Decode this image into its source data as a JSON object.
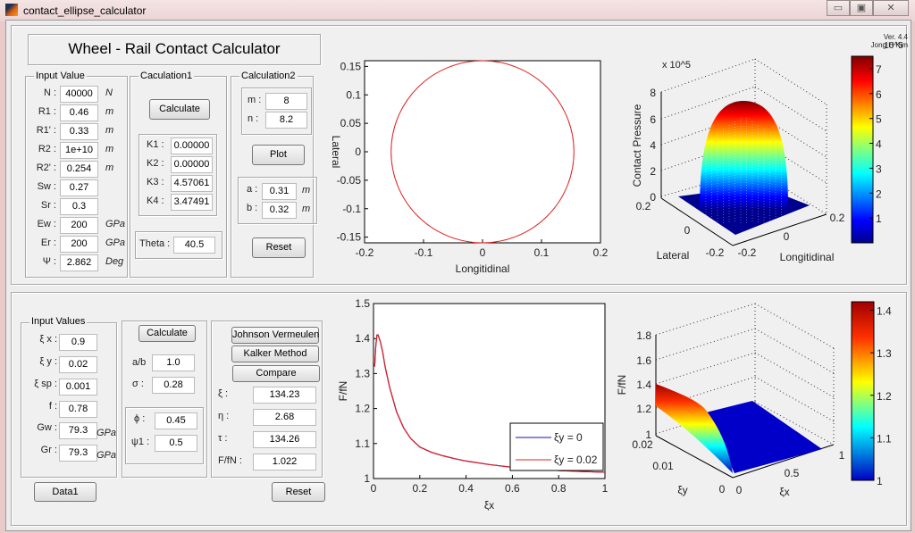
{
  "window": {
    "title": "contact_ellipse_calculator",
    "controls": [
      "minimize",
      "maximize",
      "close"
    ]
  },
  "header": {
    "title": "Wheel - Rail Contact Calculator",
    "version": "Ver. 4.4",
    "author": "Jong H Kim"
  },
  "top": {
    "input_group": {
      "label": "Input Value",
      "rows": [
        {
          "label": "N :",
          "value": "40000",
          "unit": "N"
        },
        {
          "label": "R1 :",
          "value": "0.46",
          "unit": "m"
        },
        {
          "label": "R1' :",
          "value": "0.33",
          "unit": "m"
        },
        {
          "label": "R2 :",
          "value": "1e+10",
          "unit": "m"
        },
        {
          "label": "R2' :",
          "value": "0.254",
          "unit": "m"
        },
        {
          "label": "Sw :",
          "value": "0.27",
          "unit": ""
        },
        {
          "label": "Sr :",
          "value": "0.3",
          "unit": ""
        },
        {
          "label": "Ew :",
          "value": "200",
          "unit": "GPa"
        },
        {
          "label": "Er :",
          "value": "200",
          "unit": "GPa"
        },
        {
          "label": "Ψ :",
          "value": "2.862",
          "unit": "Deg"
        }
      ]
    },
    "calc1": {
      "label": "Caculation1",
      "button": "Calculate",
      "rows": [
        {
          "label": "K1 :",
          "value": "0.00000"
        },
        {
          "label": "K2 :",
          "value": "0.00000"
        },
        {
          "label": "K3 :",
          "value": "4.57061"
        },
        {
          "label": "K4 :",
          "value": "3.47491"
        }
      ],
      "theta_label": "Theta :",
      "theta_value": "40.5"
    },
    "calc2": {
      "label": "Calculation2",
      "m_label": "m :",
      "m_value": "8",
      "n_label": "n :",
      "n_value": "8.2",
      "plot_button": "Plot",
      "a_label": "a :",
      "a_value": "0.31",
      "a_unit": "m",
      "b_label": "b :",
      "b_value": "0.32",
      "b_unit": "m",
      "reset_button": "Reset"
    }
  },
  "bottom": {
    "input_group": {
      "label": "Input Values",
      "rows": [
        {
          "label": "ξ x :",
          "value": "0.9",
          "unit": ""
        },
        {
          "label": "ξ y :",
          "value": "0.02",
          "unit": ""
        },
        {
          "label": "ξ sp :",
          "value": "0.001",
          "unit": ""
        },
        {
          "label": "f :",
          "value": "0.78",
          "unit": ""
        },
        {
          "label": "Gw :",
          "value": "79.3",
          "unit": "GPa"
        },
        {
          "label": "Gr :",
          "value": "79.3",
          "unit": "GPa"
        }
      ]
    },
    "middle": {
      "button": "Calculate",
      "ab_label": "a/b",
      "ab_value": "1.0",
      "sigma_label": "σ :",
      "sigma_value": "0.28",
      "phi_label": "ϕ :",
      "phi_value": "0.45",
      "psi_label": "ψ1 :",
      "psi_value": "0.5"
    },
    "right": {
      "jv_button": "Johnson Vermeulen",
      "kalker_button": "Kalker Method",
      "compare_button": "Compare",
      "rows": [
        {
          "label": "ξ :",
          "value": "134.23"
        },
        {
          "label": "η :",
          "value": "2.68"
        },
        {
          "label": "τ :",
          "value": "134.26"
        },
        {
          "label": "F/fN :",
          "value": "1.022"
        }
      ]
    },
    "data1_button": "Data1",
    "reset_button": "Reset"
  },
  "chart_data": [
    {
      "type": "line",
      "xlabel": "Longitidinal",
      "ylabel": "Lateral",
      "xlim": [
        -0.2,
        0.2
      ],
      "ylim": [
        -0.16,
        0.16
      ],
      "xticks": [
        "-0.2",
        "-0.1",
        "0",
        "0.1",
        "0.2"
      ],
      "yticks": [
        "0.15",
        "0.1",
        "0.05",
        "0",
        "-0.05",
        "-0.1",
        "-0.15"
      ],
      "series": [
        {
          "shape": "ellipse",
          "semi_axis_x": 0.155,
          "semi_axis_y": 0.16,
          "color": "#e02020"
        }
      ]
    },
    {
      "type": "surface3d",
      "zlabel": "Contact Pressure",
      "xlabel": "Longitidinal",
      "ylabel": "Lateral",
      "zscale": "x 10^5",
      "zticks": [
        "0",
        "2",
        "4",
        "6",
        "8"
      ],
      "xticks": [
        "-0.2",
        "0",
        "0.2"
      ],
      "yticks": [
        "0.2",
        "0",
        "-0.2"
      ],
      "zmax": 7.5,
      "colorbar": {
        "ticks": [
          "1",
          "2",
          "3",
          "4",
          "5",
          "6",
          "7"
        ],
        "exponent": "10^5",
        "range": [
          0,
          7.5
        ]
      }
    },
    {
      "type": "line",
      "xlabel": "ξx",
      "ylabel": "F/fN",
      "xlim": [
        0,
        1
      ],
      "ylim": [
        1,
        1.5
      ],
      "xticks": [
        "0",
        "0.2",
        "0.4",
        "0.6",
        "0.8",
        "1"
      ],
      "yticks": [
        "1.5",
        "1.4",
        "1.3",
        "1.2",
        "1.1",
        "1"
      ],
      "legend": "bottom-right",
      "x": [
        0.005,
        0.01,
        0.015,
        0.02,
        0.03,
        0.04,
        0.05,
        0.07,
        0.1,
        0.13,
        0.16,
        0.2,
        0.25,
        0.3,
        0.35,
        0.4,
        0.5,
        0.6,
        0.7,
        0.8,
        0.9,
        1.0
      ],
      "series": [
        {
          "name": "ξy = 0",
          "color": "#1010c0",
          "values": [
            1.32,
            1.38,
            1.41,
            1.41,
            1.39,
            1.36,
            1.32,
            1.26,
            1.19,
            1.145,
            1.115,
            1.09,
            1.075,
            1.065,
            1.057,
            1.05,
            1.04,
            1.032,
            1.027,
            1.023,
            1.02,
            1.018
          ]
        },
        {
          "name": "ξy = 0.02",
          "color": "#e02020",
          "values": [
            1.32,
            1.38,
            1.41,
            1.41,
            1.39,
            1.36,
            1.32,
            1.26,
            1.19,
            1.145,
            1.115,
            1.09,
            1.075,
            1.065,
            1.057,
            1.05,
            1.04,
            1.032,
            1.027,
            1.023,
            1.02,
            1.018
          ]
        }
      ]
    },
    {
      "type": "surface3d",
      "zlabel": "F/fN",
      "xlabel": "ξx",
      "ylabel": "ξy",
      "zticks": [
        "1",
        "1.2",
        "1.4",
        "1.6",
        "1.8"
      ],
      "xticks": [
        "0",
        "0.5",
        "1"
      ],
      "yticks": [
        "0.02",
        "0.01",
        "0"
      ],
      "colorbar": {
        "ticks": [
          "1",
          "1.1",
          "1.2",
          "1.3",
          "1.4"
        ],
        "range": [
          1,
          1.42
        ]
      }
    }
  ]
}
